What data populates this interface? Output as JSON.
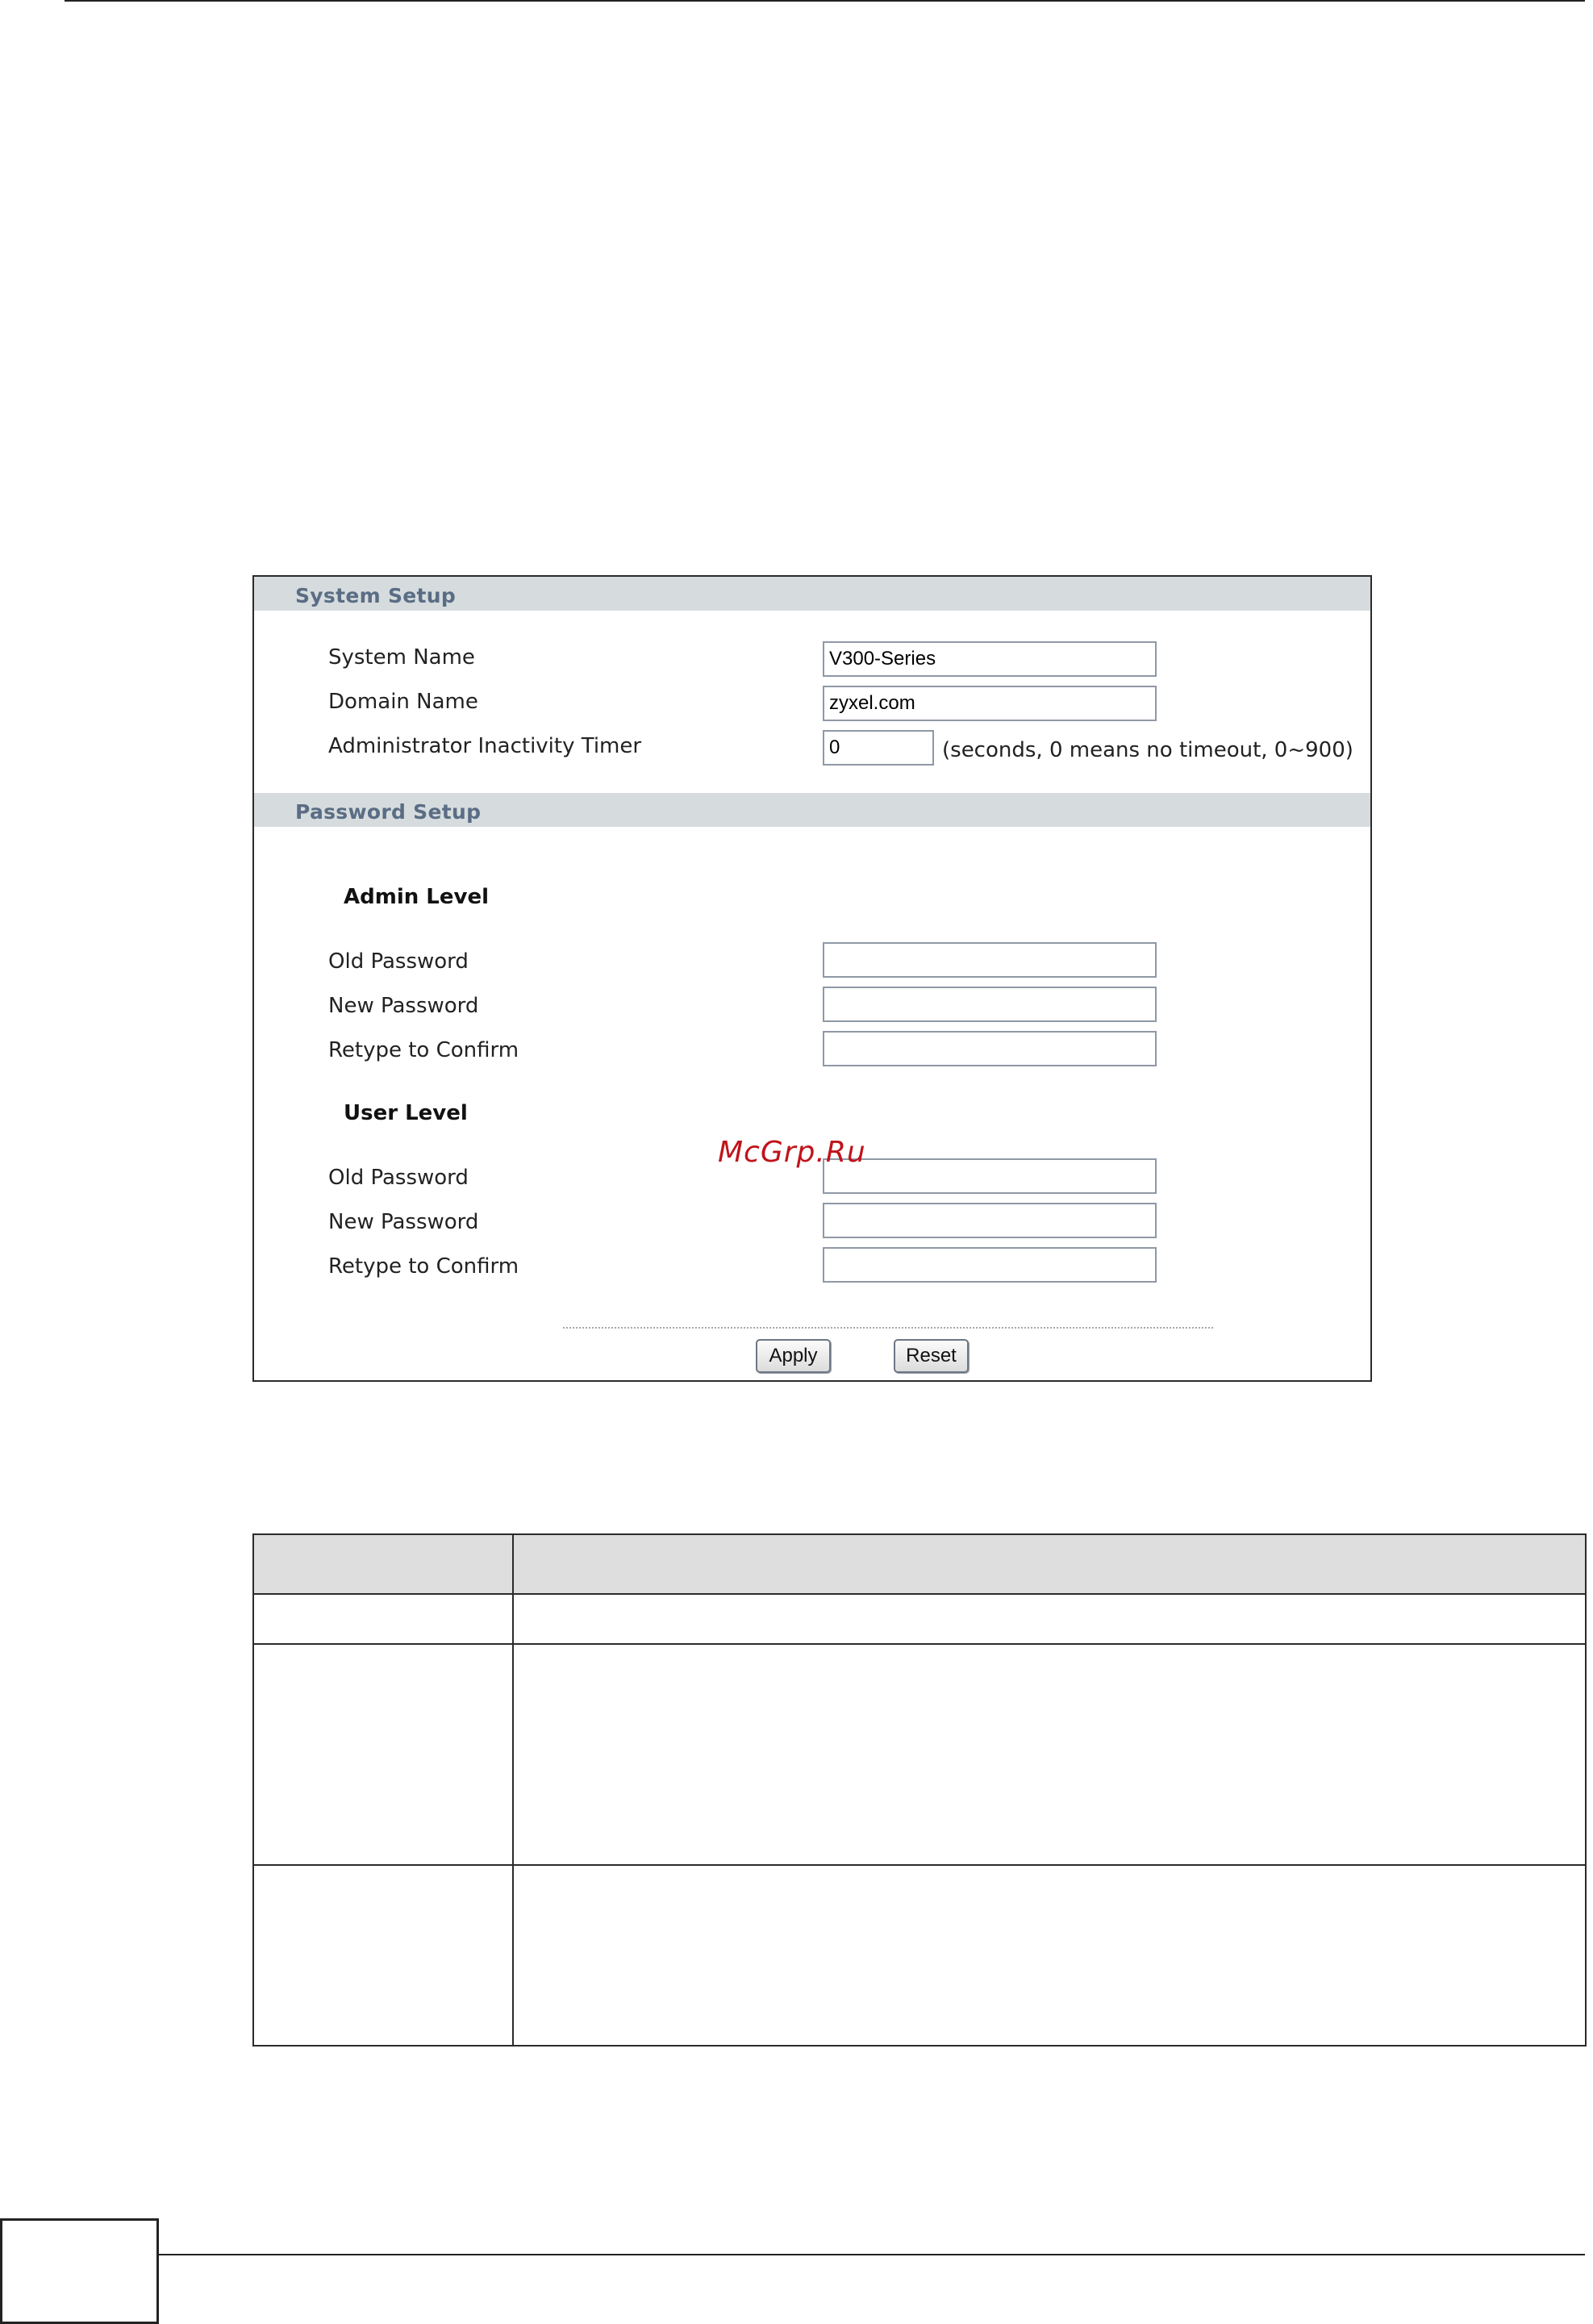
{
  "system_setup": {
    "title": "System Setup",
    "system_name_label": "System Name",
    "system_name_value": "V300-Series",
    "domain_name_label": "Domain Name",
    "domain_name_value": "zyxel.com",
    "timer_label": "Administrator Inactivity Timer",
    "timer_value": "0",
    "timer_hint": "(seconds, 0 means no timeout, 0~900)"
  },
  "password_setup": {
    "title": "Password Setup",
    "admin_heading": "Admin Level",
    "user_heading": "User Level",
    "old_password_label": "Old Password",
    "new_password_label": "New Password",
    "retype_label": "Retype to Confirm"
  },
  "buttons": {
    "apply": "Apply",
    "reset": "Reset"
  },
  "watermark": "McGrp.Ru"
}
